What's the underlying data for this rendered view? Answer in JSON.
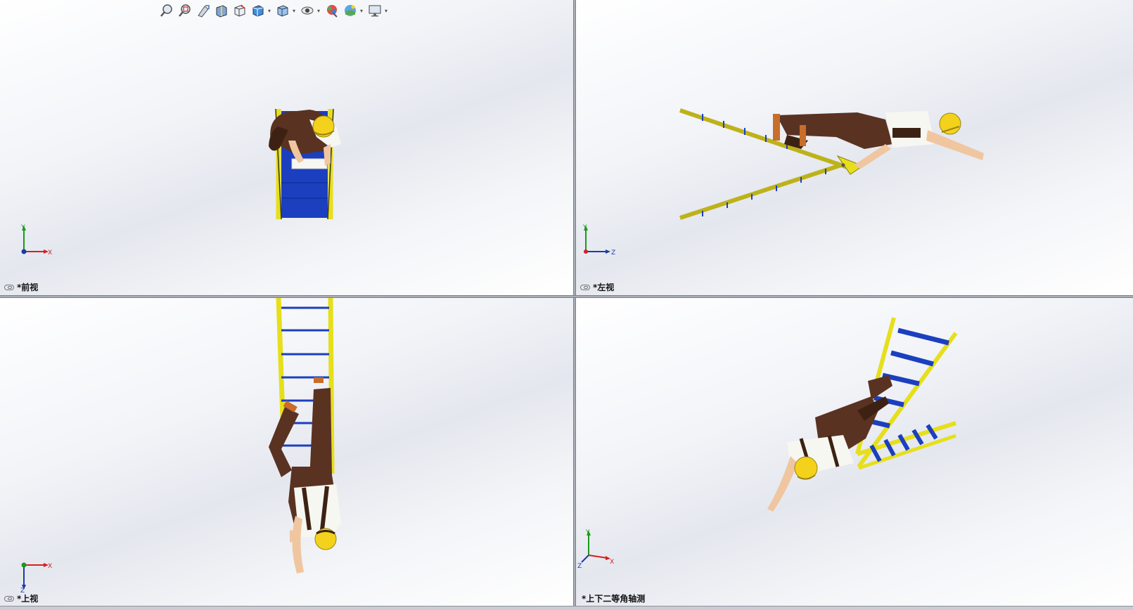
{
  "views": {
    "front": {
      "label": "*前视"
    },
    "left": {
      "label": "*左视"
    },
    "top": {
      "label": "*上视"
    },
    "dimetric": {
      "label": "*上下二等角轴测"
    }
  },
  "axes": {
    "x": "X",
    "y": "Y",
    "z": "Z"
  },
  "toolbar": {
    "icons": [
      "zoom-to-fit-icon",
      "zoom-to-area-icon",
      "previous-view-icon",
      "section-view-icon",
      "view-orientation-icon",
      "display-style-icon",
      "hide-show-items-icon",
      "edit-appearance-icon",
      "apply-scene-icon",
      "view-settings-icon"
    ]
  },
  "colors": {
    "ladder_rail": "#e6df1a",
    "ladder_rung": "#1b3fbf",
    "pants": "#5a3222",
    "helmet": "#f4d21c",
    "shirt": "#f7f7f2",
    "skin": "#f0c6a0"
  }
}
